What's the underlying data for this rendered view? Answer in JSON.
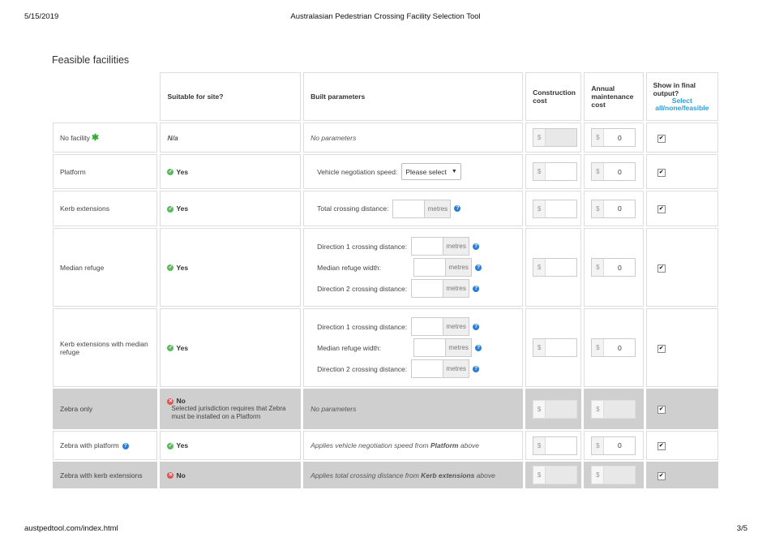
{
  "header": {
    "date": "5/15/2019",
    "title": "Australasian Pedestrian Crossing Facility Selection Tool"
  },
  "footer": {
    "url": "austpedtool.com/index.html",
    "page": "3/5"
  },
  "section_title": "Feasible facilities",
  "columns": {
    "suitable": "Suitable for site?",
    "built": "Built parameters",
    "construction": "Construction cost",
    "maintenance": "Annual maintenance cost",
    "show": "Show in final output?",
    "select_all": "Select all/none/feasible"
  },
  "labels": {
    "yes": "Yes",
    "no": "No",
    "na": "N/a",
    "no_parameters": "No parameters",
    "currency": "$",
    "metres": "metres",
    "vehicle_speed": "Vehicle negotiation speed:",
    "please_select": "Please select",
    "total_crossing": "Total crossing distance:",
    "dir1": "Direction 1 crossing distance:",
    "median_width": "Median refuge width:",
    "dir2": "Direction 2 crossing distance:",
    "zebra_note": "Selected jurisdiction requires that Zebra must be installed on a Platform",
    "applies_speed_pre": "Applies vehicle negotiation speed from ",
    "applies_speed_bold": "Platform",
    "applies_speed_post": " above",
    "applies_dist_pre": "Applies total crossing distance from ",
    "applies_dist_bold": "Kerb extensions",
    "applies_dist_post": " above",
    "checkmark": "✔"
  },
  "rows": {
    "no_facility": {
      "name": "No facility",
      "maintenance": "0"
    },
    "platform": {
      "name": "Platform",
      "maintenance": "0"
    },
    "kerb_ext": {
      "name": "Kerb extensions",
      "maintenance": "0"
    },
    "median": {
      "name": "Median refuge",
      "maintenance": "0"
    },
    "kerb_median": {
      "name": "Kerb extensions with median refuge",
      "maintenance": "0"
    },
    "zebra_only": {
      "name": "Zebra only"
    },
    "zebra_platform": {
      "name": "Zebra with platform",
      "maintenance": "0"
    },
    "zebra_kerb": {
      "name": "Zebra with kerb extensions"
    }
  },
  "colors": {
    "yes": "#5cb85c",
    "no": "#d9534f",
    "link": "#2a9fd6",
    "disabled_row": "#cfcfcf"
  },
  "icons": [
    "check-circle-icon",
    "x-circle-icon",
    "help-icon",
    "asterisk-icon",
    "caret-down-icon",
    "checkbox-checked-icon"
  ]
}
